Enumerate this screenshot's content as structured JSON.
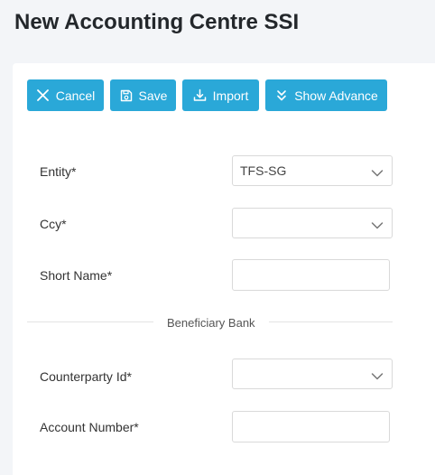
{
  "page": {
    "title": "New Accounting Centre SSI"
  },
  "toolbar": {
    "cancel_label": "Cancel",
    "save_label": "Save",
    "import_label": "Import",
    "advance_label": "Show Advance"
  },
  "form": {
    "entity": {
      "label": "Entity*",
      "value": "TFS-SG"
    },
    "ccy": {
      "label": "Ccy*",
      "value": ""
    },
    "short_name": {
      "label": "Short Name*",
      "value": ""
    },
    "section_beneficiary": "Beneficiary Bank",
    "counterparty_id": {
      "label": "Counterparty Id*",
      "value": ""
    },
    "account_number": {
      "label": "Account Number*",
      "value": ""
    }
  },
  "icons": {
    "cancel": "close-icon",
    "save": "save-icon",
    "import": "download-icon",
    "advance": "double-chevron-down-icon",
    "select": "chevron-down-icon"
  },
  "colors": {
    "accent": "#2aa8d8",
    "background": "#f3f5f8",
    "card": "#ffffff",
    "border": "#d9d9d9"
  }
}
